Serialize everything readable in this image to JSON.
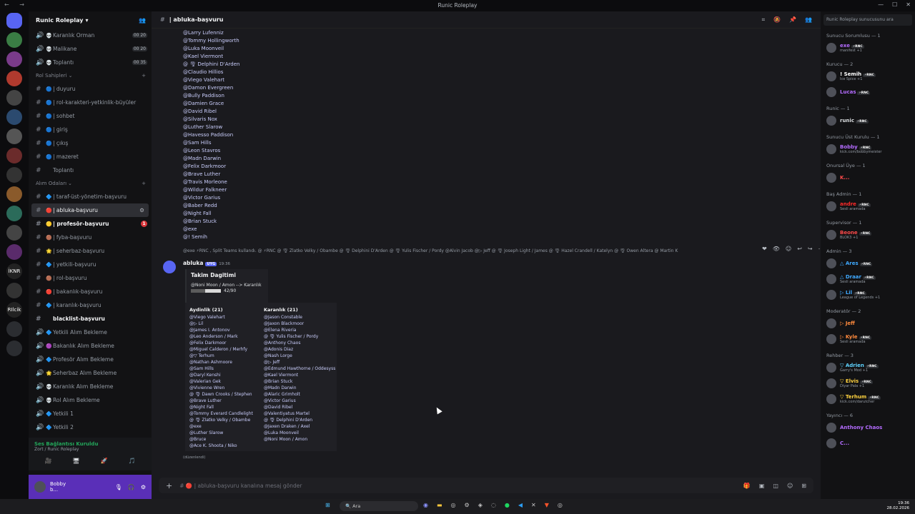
{
  "app": {
    "title": "Runic Roleplay"
  },
  "server": {
    "name": "Runic Roleplay",
    "dropdown": "▾"
  },
  "guild_labels": [
    "",
    "",
    "",
    "",
    "",
    "",
    "",
    "",
    "",
    "",
    "",
    "",
    "",
    "İKNR",
    "",
    "RIlcik",
    "",
    ""
  ],
  "channels_top": [
    {
      "emoji": "💀",
      "name": "Karanlık Orman",
      "badge": "00 20"
    },
    {
      "emoji": "💀",
      "name": "Malikane",
      "badge": "00 20"
    },
    {
      "emoji": "💀",
      "name": "Toplantı",
      "badge": "00 35"
    }
  ],
  "category_rol": {
    "label": "Rol Sahipleri",
    "chevron": "⌄",
    "plus": "+"
  },
  "channels_rol": [
    {
      "emoji": "🔵",
      "name": "| duyuru"
    },
    {
      "emoji": "🔵",
      "name": "| rol-karakteri-yetkinlik-büyüler"
    },
    {
      "emoji": "🔵",
      "name": "| sohbet"
    },
    {
      "emoji": "🔵",
      "name": "| giriş"
    },
    {
      "emoji": "🔵",
      "name": "| çıkış"
    },
    {
      "emoji": "🔵",
      "name": "| mazeret"
    },
    {
      "emoji": "",
      "name": "Toplantı"
    }
  ],
  "category_alim": {
    "label": "Alım Odaları",
    "chevron": "⌄",
    "plus": "+"
  },
  "channels_alim": [
    {
      "emoji": "🔷",
      "name": "| taraf-üst-yönetim-başvuru",
      "active": false
    },
    {
      "emoji": "🔴",
      "name": "| abluka-başvuru",
      "active": true
    },
    {
      "emoji": "🟡",
      "name": "| profesör-başvuru",
      "bold": true,
      "red": "1"
    },
    {
      "emoji": "🟤",
      "name": "| fyba-başvuru"
    },
    {
      "emoji": "🌟",
      "name": "| seherbaz-başvuru"
    },
    {
      "emoji": "🔷",
      "name": "| yetkili-başvuru"
    },
    {
      "emoji": "🟤",
      "name": "| rol-başvuru"
    },
    {
      "emoji": "🔴",
      "name": "| bakanlık-başvuru"
    },
    {
      "emoji": "🔷",
      "name": "| karanlık-başvuru"
    },
    {
      "emoji": "",
      "name": "blacklist-başvuru",
      "bold": true
    }
  ],
  "channels_bekleme": [
    {
      "emoji": "🔷",
      "name": "Yetkili Alım Bekleme"
    },
    {
      "emoji": "🟣",
      "name": "Bakanlık Alım Bekleme"
    },
    {
      "emoji": "🔷",
      "name": "Profesör Alım Bekleme"
    },
    {
      "emoji": "🌟",
      "name": "Seherbaz Alım Bekleme"
    },
    {
      "emoji": "💀",
      "name": "Karanlık Alım Bekleme"
    },
    {
      "emoji": "💀",
      "name": "Rol Alım Bekleme"
    },
    {
      "emoji": "🔷",
      "name": "Yetkili 1"
    },
    {
      "emoji": "🔷",
      "name": "Yetkili 2"
    }
  ],
  "voice": {
    "status": "Ses Bağlantısı Kuruldu",
    "sub": "Zort / Runic Roleplay"
  },
  "user": {
    "name": "Bobby",
    "sub": "b..."
  },
  "channel_header": {
    "name": "| abluka-başvuru"
  },
  "mentions": [
    "@Larry Lufenniz",
    "@Tommy Hollingworth",
    "@Luka Moonveil",
    "@Kael Viermont",
    "@ 🌪 Delphini D'Arden",
    "@Claudio Hillios",
    "@Viego Valehart",
    "@Damon Evergreen",
    "@Bully Paddison",
    "@Damien Grace",
    "@David Ribel",
    "@Silvaris Nox",
    "@Luther Slarow",
    "@Havesso Paddison",
    "@Sam Hills",
    "@Leon Stavros",
    "@Madn Darwin",
    "@Felix Darkmoor",
    "@Brave Luther",
    "@Travis Morleone",
    "@Wildur Falkneer",
    "@Victor Garius",
    "@Baber Redd",
    "@Night Fall",
    "@Brian Stuck",
    "@exe",
    "@! Semih"
  ],
  "reply_line": "@exe ⚡RNC , Split Teams kullandı. @ ⚡RNC @ 🌪 Zlatko Velky / Obambe @ 🌪 Delphini D'Arden @ 🌪 Yulis Fischer / Pordy @Alvin Jacob @▷ Jeff @ 🌪 Joseph Light / James @ 🌪 Hazel Crandell / Katelyn @ 🌪 Owen Altera @ Martin K",
  "message": {
    "author": "abluka",
    "tag": "UYG",
    "time": "19:36"
  },
  "embed1": {
    "title": "Takim Dagitimi",
    "desc": "@Noni Moon / Amon --> Karanlık",
    "progress_text": "42/90",
    "progress": 0.47
  },
  "team_light": {
    "title": "Aydinlik (21)",
    "members": [
      "@Viego Valehart",
      "@▷ Lil",
      "@James I. Antonov",
      "@Leo Anderson / Mark",
      "@Felix Darkmoor",
      "@Miguel Calderon / Merhfy",
      "@▽ Terhum",
      "@Nathan Ashmoore",
      "@Sam Hills",
      "@Daryl Kenshi",
      "@Valerian Gek",
      "@Vivienne Wren",
      "@ 🌪 Dawn Crooks / Stephen",
      "@Brave Luther",
      "@Night Fall",
      "@Tommy Everard Candlelight",
      "@ 🌪 Zlatko Velky / Obambe",
      "@exe",
      "@Luther Slarow",
      "@Bruce",
      "@Ace K. Shoota / Niko"
    ]
  },
  "team_dark": {
    "title": "Karanlık (21)",
    "members": [
      "@Jason Constable",
      "@Jaxon Blackmoor",
      "@Elena Riveria",
      "@ 🌪 Yulis Fischer / Pordy",
      "@Anthony Chaos",
      "@Adonis Diaz",
      "@Nash Lorge",
      "@▷ Jeff",
      "@Edmund Hawthorne / Oddesyss",
      "@Kael Viermont",
      "@Brian Stuck",
      "@Madn Darwin",
      "@Alaric Grimholt",
      "@Victor Garius",
      "@David Ribel",
      "@Valentiyatus Martel",
      "@ 🌪 Delphini D'Arden",
      "@Jaxen Draken / Axel",
      "@Luka Moonveil",
      "@Noni Moon / Amon"
    ]
  },
  "edited": "(düzenlendi)",
  "composer": {
    "placeholder": "# 🔴 | abluka-başvuru kanalına mesaj gönder"
  },
  "member_search": "Runic Roleplay sunucusunu ara",
  "member_groups": [
    {
      "label": "Sunucu Sorumlusu — 1",
      "members": [
        {
          "name": "exe",
          "color": "#b46cff",
          "status": "manifest +1",
          "tag": "⚡RNC"
        }
      ]
    },
    {
      "label": "Kurucu — 2",
      "members": [
        {
          "name": "! Semih",
          "color": "#ffffff",
          "status": "Ice Spice +1",
          "tag": "⚡RNC"
        },
        {
          "name": "Lucas",
          "color": "#b46cff",
          "status": "",
          "tag": "⚡RNC"
        }
      ]
    },
    {
      "label": "Runic — 1",
      "members": [
        {
          "name": "runic",
          "color": "#dbdee1",
          "status": "",
          "tag": "⚡RNC"
        }
      ]
    },
    {
      "label": "Sunucu Üst Kurulu — 1",
      "members": [
        {
          "name": "Bobby",
          "color": "#b46cff",
          "status": "kick.com/bobbymeister",
          "tag": "⚡RNC"
        }
      ]
    },
    {
      "label": "Onursal Üye — 1",
      "members": [
        {
          "name": "K...",
          "color": "#ff4b4b",
          "status": "",
          "tag": ""
        }
      ]
    },
    {
      "label": "Baş Admin — 1",
      "members": [
        {
          "name": "andre",
          "color": "#ff2a2a",
          "status": "Sesli aramada",
          "tag": "⚡RNC"
        }
      ]
    },
    {
      "label": "Supervisor — 1",
      "members": [
        {
          "name": "Beone",
          "color": "#ff4b4b",
          "status": "BLOK3 +1",
          "tag": "⚡RNC"
        }
      ]
    },
    {
      "label": "Admin — 3",
      "members": [
        {
          "name": "△ Ares",
          "color": "#3fa9ff",
          "status": "",
          "tag": "⚡RNC"
        },
        {
          "name": "△ Draar",
          "color": "#3fa9ff",
          "status": "Sesli aramada",
          "tag": "⚡RNC"
        },
        {
          "name": "▷ Lil",
          "color": "#3fa9ff",
          "status": "League of Legends +1",
          "tag": "⚡RNC"
        }
      ]
    },
    {
      "label": "Moderatör — 2",
      "members": [
        {
          "name": "▷ Jeff",
          "color": "#ff8a3d",
          "status": "",
          "tag": ""
        },
        {
          "name": "▷ Kyle",
          "color": "#ff8a3d",
          "status": "Sesli aramada",
          "tag": "⚡RNC"
        }
      ]
    },
    {
      "label": "Rehber — 3",
      "members": [
        {
          "name": "▽ Adrien",
          "color": "#5fd3ff",
          "status": "Garry's Mod +1",
          "tag": "⚡RNC"
        },
        {
          "name": "▽ Elvis",
          "color": "#ffd23f",
          "status": "Diyar Pala +1",
          "tag": "⚡RNC"
        },
        {
          "name": "▽ Terhum",
          "color": "#ffd23f",
          "status": "kick.com/darutcher",
          "tag": "⚡RNC"
        }
      ]
    },
    {
      "label": "Yayıncı — 6",
      "members": [
        {
          "name": "Anthony Chaos",
          "color": "#b46cff",
          "status": "",
          "tag": ""
        },
        {
          "name": "C...",
          "color": "#b46cff",
          "status": "",
          "tag": ""
        }
      ]
    }
  ],
  "taskbar": {
    "search": "Ara",
    "time": "19:36",
    "date": "28.02.2026"
  }
}
